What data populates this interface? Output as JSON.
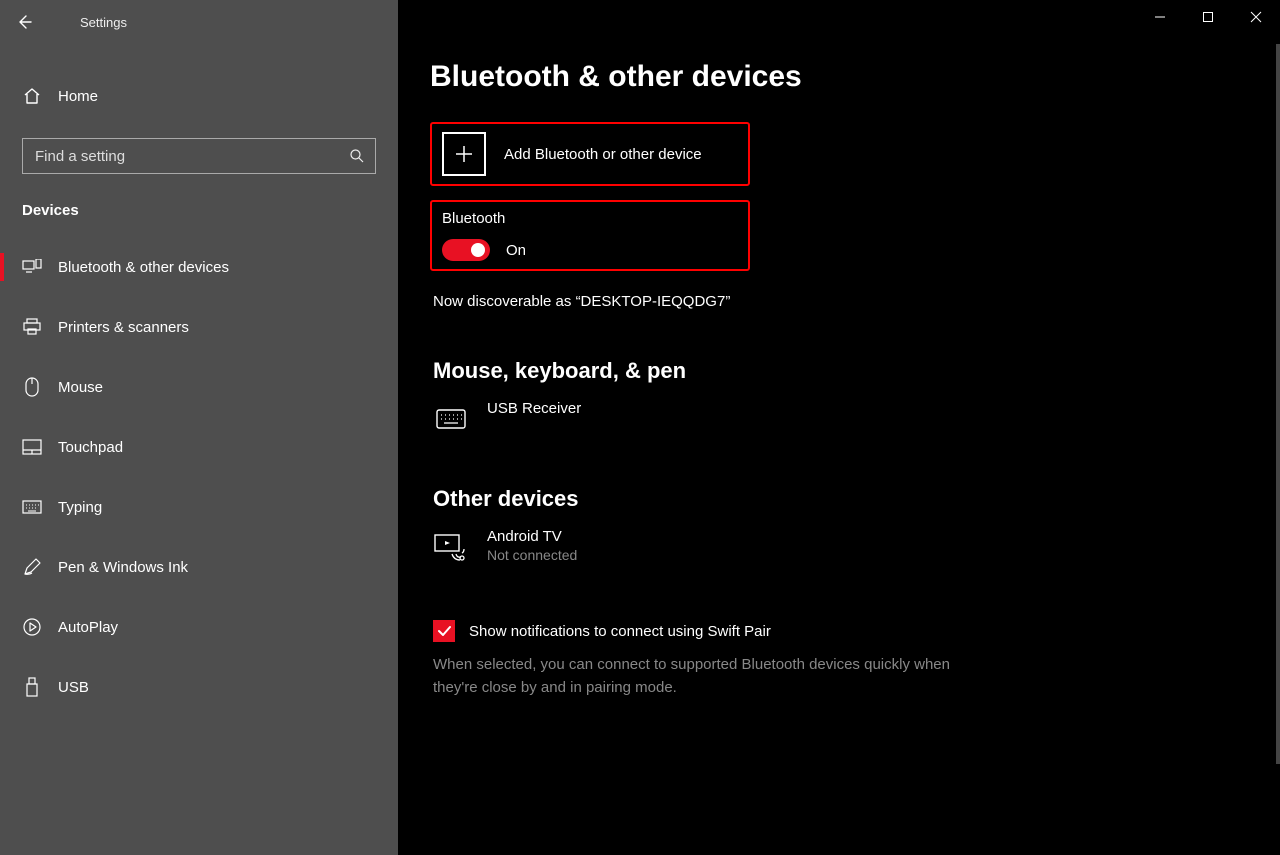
{
  "app": {
    "title": "Settings"
  },
  "window_controls": {
    "minimize": "minimize",
    "maximize": "maximize",
    "close": "close"
  },
  "sidebar": {
    "home": "Home",
    "search_placeholder": "Find a setting",
    "section": "Devices",
    "items": [
      {
        "id": "bluetooth",
        "label": "Bluetooth & other devices",
        "active": true
      },
      {
        "id": "printers",
        "label": "Printers & scanners"
      },
      {
        "id": "mouse",
        "label": "Mouse"
      },
      {
        "id": "touchpad",
        "label": "Touchpad"
      },
      {
        "id": "typing",
        "label": "Typing"
      },
      {
        "id": "pen",
        "label": "Pen & Windows Ink"
      },
      {
        "id": "autoplay",
        "label": "AutoPlay"
      },
      {
        "id": "usb",
        "label": "USB"
      }
    ]
  },
  "main": {
    "page_title": "Bluetooth & other devices",
    "add_device": {
      "label": "Add Bluetooth or other device"
    },
    "bluetooth": {
      "heading": "Bluetooth",
      "state": "On",
      "enabled": true
    },
    "discoverable": "Now discoverable as “DESKTOP-IEQQDG7”",
    "sections": {
      "mouse_keyboard_pen": {
        "heading": "Mouse, keyboard, & pen",
        "devices": [
          {
            "name": "USB Receiver",
            "status": ""
          }
        ]
      },
      "other_devices": {
        "heading": "Other devices",
        "devices": [
          {
            "name": "Android TV",
            "status": "Not connected"
          }
        ]
      }
    },
    "swift_pair": {
      "checked": true,
      "label": "Show notifications to connect using Swift Pair",
      "description": "When selected, you can connect to supported Bluetooth devices quickly when they're close by and in pairing mode."
    }
  }
}
